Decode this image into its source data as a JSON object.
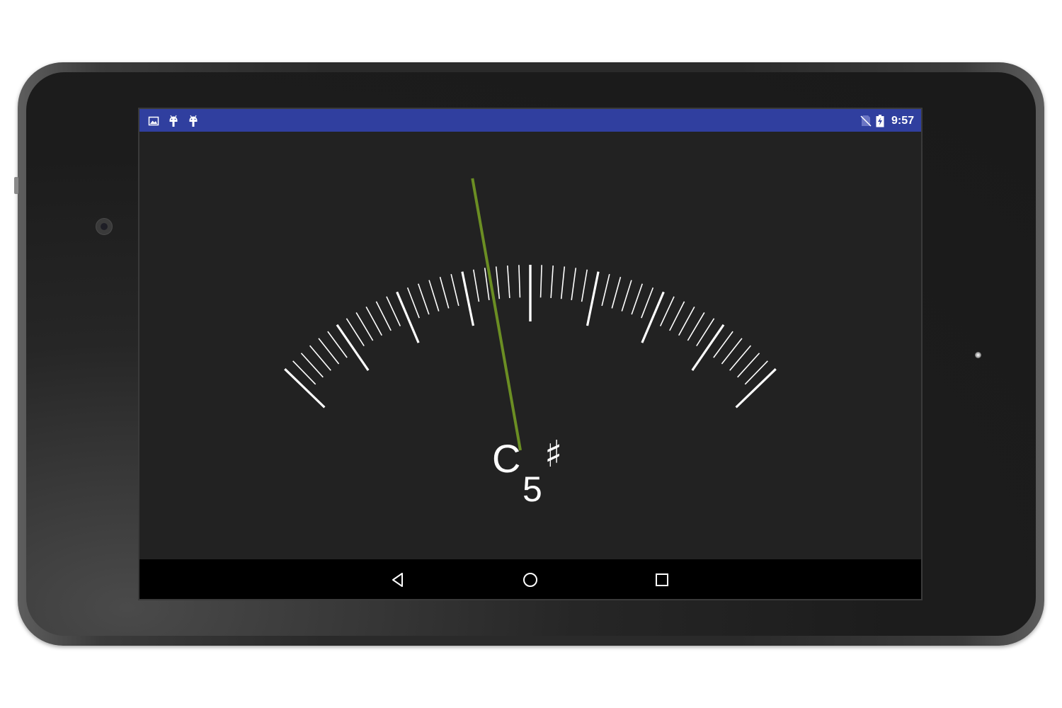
{
  "device": {
    "name": "android-tablet",
    "bezel_color": "#2a2a2a"
  },
  "status_bar": {
    "background": "#303f9f",
    "left_icons": [
      "image-notification-icon",
      "android-debug-icon",
      "android-debug-icon"
    ],
    "right_icons": [
      "no-sim-icon",
      "battery-charging-icon"
    ],
    "time": "9:57"
  },
  "tuner": {
    "note_letter": "C",
    "octave": "5",
    "accidental": "♯",
    "needle_color": "#6b8e23",
    "needle_angle_deg": -10,
    "scale_span_deg": 92,
    "tick_count": 49,
    "colors": {
      "background": "#222222",
      "ticks": "#ffffff",
      "text": "#ffffff"
    }
  },
  "nav_bar": {
    "background": "#000000",
    "buttons": [
      "back-icon",
      "home-icon",
      "recents-icon"
    ]
  }
}
